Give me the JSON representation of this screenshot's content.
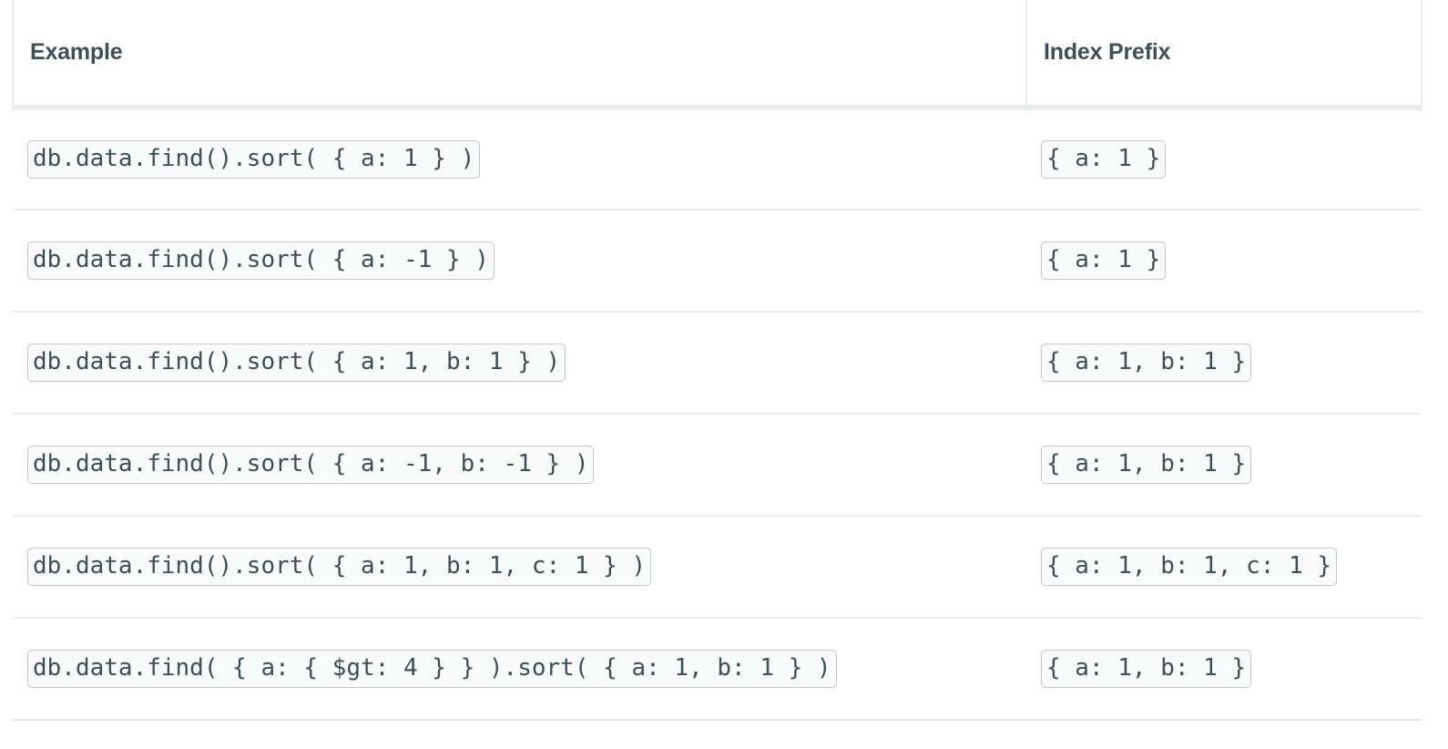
{
  "table": {
    "headers": {
      "example": "Example",
      "index_prefix": "Index Prefix"
    },
    "rows": [
      {
        "example": "db.data.find().sort( { a: 1 } )",
        "index_prefix": "{ a: 1 }"
      },
      {
        "example": "db.data.find().sort( { a: -1 } )",
        "index_prefix": "{ a: 1 }"
      },
      {
        "example": "db.data.find().sort( { a: 1, b: 1 } )",
        "index_prefix": "{ a: 1, b: 1 }"
      },
      {
        "example": "db.data.find().sort( { a: -1, b: -1 } )",
        "index_prefix": "{ a: 1, b: 1 }"
      },
      {
        "example": "db.data.find().sort( { a: 1, b: 1, c: 1 } )",
        "index_prefix": "{ a: 1, b: 1, c: 1 }"
      },
      {
        "example": "db.data.find( { a: { $gt: 4 } } ).sort( { a: 1, b: 1 } )",
        "index_prefix": "{ a: 1, b: 1 }"
      }
    ]
  },
  "colors": {
    "header_text": "#3d4f58",
    "header_border": "#e8edeb",
    "row_divider": "#ebebeb",
    "code_text": "#3d4f58",
    "code_background": "#f9fbfa",
    "code_border": "#c1c7c6",
    "page_background": "#ffffff"
  }
}
